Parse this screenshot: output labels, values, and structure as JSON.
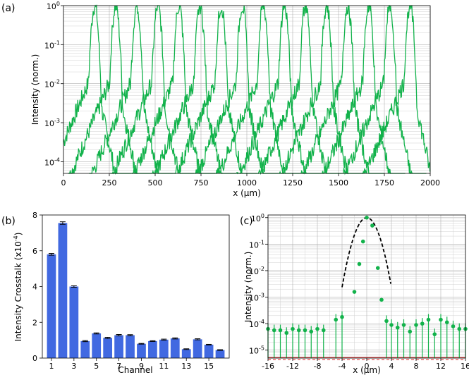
{
  "chart_data": [
    {
      "id": "a",
      "type": "line",
      "panel_label": "(a)",
      "xlabel": "x (µm)",
      "ylabel": "Intensity (norm.)",
      "xlim": [
        0,
        2000
      ],
      "ylim_log10": [
        -4.3,
        0
      ],
      "yscale": "log",
      "grid": true,
      "color": "#12b24b",
      "x_ticks": [
        "0",
        "250",
        "500",
        "750",
        "1000",
        "1250",
        "1500",
        "1750",
        "2000"
      ],
      "y_ticks": [
        {
          "base": "10",
          "exp": "-4",
          "log": -4
        },
        {
          "base": "10",
          "exp": "-3",
          "log": -3
        },
        {
          "base": "10",
          "exp": "-2",
          "log": -2
        },
        {
          "base": "10",
          "exp": "-1",
          "log": -1
        },
        {
          "base": "10",
          "exp": "0",
          "log": 0
        }
      ],
      "peak_positions": [
        170,
        285,
        400,
        515,
        630,
        745,
        860,
        975,
        1090,
        1205,
        1320,
        1435,
        1550,
        1665,
        1780,
        1890
      ]
    },
    {
      "id": "b",
      "type": "bar",
      "panel_label": "(b)",
      "xlabel": "Channel",
      "ylabel": "Intensity Crosstalk (x10",
      "ylabel_exp": "-4",
      "ylabel_close": ")",
      "color": "#4169e1",
      "categories": [
        1,
        2,
        3,
        4,
        5,
        6,
        7,
        8,
        9,
        10,
        11,
        12,
        13,
        14,
        15,
        16
      ],
      "values": [
        5.8,
        7.55,
        4.0,
        0.95,
        1.38,
        1.13,
        1.28,
        1.28,
        0.8,
        0.95,
        1.03,
        1.1,
        0.5,
        1.05,
        0.75,
        0.45
      ],
      "errors": [
        0.05,
        0.07,
        0.04,
        0.03,
        0.03,
        0.03,
        0.04,
        0.03,
        0.02,
        0.02,
        0.03,
        0.03,
        0.02,
        0.03,
        0.02,
        0.02
      ],
      "ylim": [
        0,
        8
      ],
      "x_ticks": [
        "1",
        "3",
        "5",
        "7",
        "9",
        "11",
        "13",
        "15"
      ],
      "y_ticks": [
        "0",
        "2",
        "4",
        "6",
        "8"
      ],
      "grid": false
    },
    {
      "id": "c",
      "type": "scatter",
      "panel_label": "(c)",
      "xlabel": "x (µm)",
      "ylabel": "Intensity (norm.)",
      "xlim": [
        -16,
        16
      ],
      "ylim_log10": [
        -5.3,
        0.1
      ],
      "yscale": "log",
      "grid": true,
      "color": "#12b24b",
      "fit_color": "#000000",
      "threshold_color": "#e02020",
      "threshold_log10": -5.28,
      "x_ticks": [
        "-16",
        "-12",
        "-8",
        "-4",
        "0",
        "4",
        "8",
        "12",
        "16"
      ],
      "y_ticks": [
        {
          "base": "10",
          "exp": "-5",
          "log": -5
        },
        {
          "base": "10",
          "exp": "-4",
          "log": -4
        },
        {
          "base": "10",
          "exp": "-3",
          "log": -3
        },
        {
          "base": "10",
          "exp": "-2",
          "log": -2
        },
        {
          "base": "10",
          "exp": "-1",
          "log": -1
        },
        {
          "base": "10",
          "exp": "0",
          "log": 0
        }
      ],
      "points": [
        {
          "x": -16,
          "log": -4.2
        },
        {
          "x": -15,
          "log": -4.25
        },
        {
          "x": -14,
          "log": -4.25
        },
        {
          "x": -13,
          "log": -4.35
        },
        {
          "x": -12,
          "log": -4.2
        },
        {
          "x": -11,
          "log": -4.25
        },
        {
          "x": -10,
          "log": -4.25
        },
        {
          "x": -9,
          "log": -4.3
        },
        {
          "x": -8,
          "log": -4.2
        },
        {
          "x": -7,
          "log": -4.25
        },
        {
          "x": -5,
          "log": -3.85
        },
        {
          "x": -4,
          "log": -3.75
        },
        {
          "x": -2,
          "log": -2.8
        },
        {
          "x": -1.2,
          "log": -1.75
        },
        {
          "x": -0.6,
          "log": -0.9
        },
        {
          "x": 0,
          "log": 0
        },
        {
          "x": 0.9,
          "log": -0.3
        },
        {
          "x": 1.8,
          "log": -1.9
        },
        {
          "x": 2.4,
          "log": -3.1
        },
        {
          "x": 3.2,
          "log": -3.9
        },
        {
          "x": 4,
          "log": -4.05
        },
        {
          "x": 5,
          "log": -4.15
        },
        {
          "x": 6,
          "log": -4.05
        },
        {
          "x": 7,
          "log": -4.3
        },
        {
          "x": 8,
          "log": -4.05
        },
        {
          "x": 9,
          "log": -4.0
        },
        {
          "x": 10,
          "log": -3.85
        },
        {
          "x": 11,
          "log": -4.4
        },
        {
          "x": 12,
          "log": -3.85
        },
        {
          "x": 13,
          "log": -3.95
        },
        {
          "x": 14,
          "log": -4.1
        },
        {
          "x": 15,
          "log": -4.2
        },
        {
          "x": 16,
          "log": -4.2
        }
      ]
    }
  ]
}
